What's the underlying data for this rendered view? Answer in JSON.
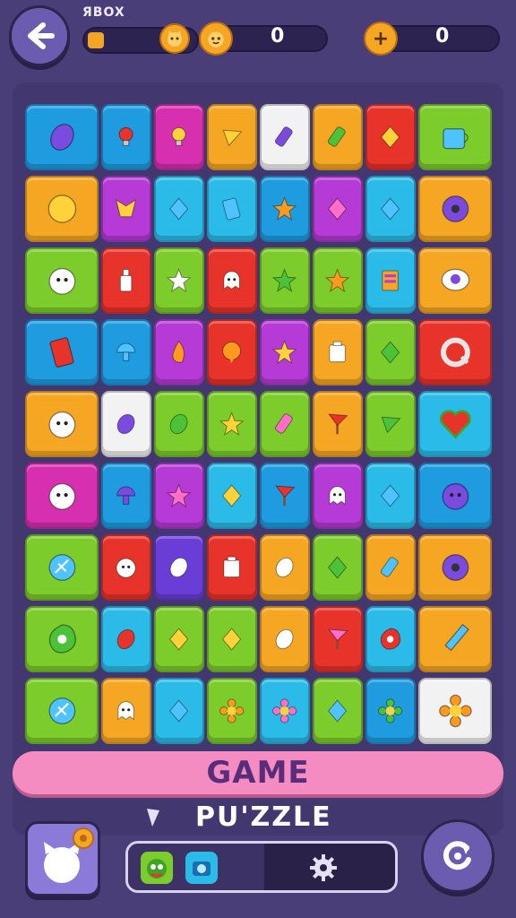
{
  "header": {
    "label": "ЯBOX",
    "progress_fraction": 0.12,
    "score": "0",
    "coins": "0",
    "back_icon": "arrow-left-icon",
    "score_icon": "cat-face-icon",
    "coins_icon": "plus-coin-icon"
  },
  "board": {
    "columns": 8,
    "tiles": [
      {
        "color": "#1f9be0",
        "icon": "purple-bean"
      },
      {
        "color": "#1f9be0",
        "icon": "red-bulb"
      },
      {
        "color": "#d62fb0",
        "icon": "yellow-bulb"
      },
      {
        "color": "#f5a623",
        "icon": "yellow-triangle"
      },
      {
        "color": "#f2f2f2",
        "icon": "purple-gem"
      },
      {
        "color": "#f5a623",
        "icon": "green-gem"
      },
      {
        "color": "#e8332b",
        "icon": "yellow-diamond"
      },
      {
        "color": "#7ccc2b",
        "icon": "blue-cup"
      },
      {
        "color": "#f5a623",
        "icon": "yellow-ball"
      },
      {
        "color": "#b53ad6",
        "icon": "yellow-cat"
      },
      {
        "color": "#2bbbe8",
        "icon": "blue-diamond"
      },
      {
        "color": "#2bbbe8",
        "icon": "blue-card"
      },
      {
        "color": "#1f9be0",
        "icon": "orange-star"
      },
      {
        "color": "#b53ad6",
        "icon": "pink-diamond"
      },
      {
        "color": "#2bbbe8",
        "icon": "blue-diamond"
      },
      {
        "color": "#f5a623",
        "icon": "purple-donut"
      },
      {
        "color": "#7ccc2b",
        "icon": "cat-face"
      },
      {
        "color": "#e8332b",
        "icon": "bottle"
      },
      {
        "color": "#7ccc2b",
        "icon": "white-star"
      },
      {
        "color": "#e8332b",
        "icon": "white-ghost"
      },
      {
        "color": "#7ccc2b",
        "icon": "green-star"
      },
      {
        "color": "#7ccc2b",
        "icon": "orange-star"
      },
      {
        "color": "#2bbbe8",
        "icon": "stripe-box"
      },
      {
        "color": "#f5a623",
        "icon": "eye"
      },
      {
        "color": "#1f9be0",
        "icon": "red-card"
      },
      {
        "color": "#1f9be0",
        "icon": "blue-mushroom"
      },
      {
        "color": "#b53ad6",
        "icon": "orange-flame"
      },
      {
        "color": "#e8332b",
        "icon": "orange-bubble"
      },
      {
        "color": "#b53ad6",
        "icon": "yellow-star"
      },
      {
        "color": "#f5a623",
        "icon": "white-jar"
      },
      {
        "color": "#7ccc2b",
        "icon": "green-diamond"
      },
      {
        "color": "#e8332b",
        "icon": "grey-ring"
      },
      {
        "color": "#f5a623",
        "icon": "cat-face"
      },
      {
        "color": "#f2f2f2",
        "icon": "purple-bean"
      },
      {
        "color": "#7ccc2b",
        "icon": "green-bean"
      },
      {
        "color": "#7ccc2b",
        "icon": "yellow-star"
      },
      {
        "color": "#7ccc2b",
        "icon": "pink-gem"
      },
      {
        "color": "#f5a623",
        "icon": "red-flag"
      },
      {
        "color": "#7ccc2b",
        "icon": "green-triangle"
      },
      {
        "color": "#2bbbe8",
        "icon": "red-heart"
      },
      {
        "color": "#d62fb0",
        "icon": "cat-face"
      },
      {
        "color": "#1f9be0",
        "icon": "purple-mushroom"
      },
      {
        "color": "#b53ad6",
        "icon": "pink-star"
      },
      {
        "color": "#2bbbe8",
        "icon": "yellow-diamond"
      },
      {
        "color": "#1f9be0",
        "icon": "red-flag"
      },
      {
        "color": "#b53ad6",
        "icon": "white-ghost"
      },
      {
        "color": "#2bbbe8",
        "icon": "blue-diamond"
      },
      {
        "color": "#1f9be0",
        "icon": "purple-face"
      },
      {
        "color": "#7ccc2b",
        "icon": "blue-shell"
      },
      {
        "color": "#e8332b",
        "icon": "cat-face"
      },
      {
        "color": "#6a3ed6",
        "icon": "white-bean"
      },
      {
        "color": "#e8332b",
        "icon": "white-jar"
      },
      {
        "color": "#f5a623",
        "icon": "white-bean"
      },
      {
        "color": "#7ccc2b",
        "icon": "green-diamond"
      },
      {
        "color": "#f5a623",
        "icon": "blue-gem"
      },
      {
        "color": "#f5a623",
        "icon": "purple-donut"
      },
      {
        "color": "#7ccc2b",
        "icon": "green-blob"
      },
      {
        "color": "#2bbbe8",
        "icon": "red-bean"
      },
      {
        "color": "#7ccc2b",
        "icon": "yellow-diamond"
      },
      {
        "color": "#7ccc2b",
        "icon": "yellow-diamond"
      },
      {
        "color": "#f5a623",
        "icon": "white-bean"
      },
      {
        "color": "#e8332b",
        "icon": "pink-flag"
      },
      {
        "color": "#2bbbe8",
        "icon": "red-blob"
      },
      {
        "color": "#f5a623",
        "icon": "blue-pencil"
      },
      {
        "color": "#7ccc2b",
        "icon": "blue-shell"
      },
      {
        "color": "#f5a623",
        "icon": "white-ghost"
      },
      {
        "color": "#2bbbe8",
        "icon": "blue-diamond"
      },
      {
        "color": "#7ccc2b",
        "icon": "orange-flower"
      },
      {
        "color": "#2bbbe8",
        "icon": "pink-flower"
      },
      {
        "color": "#7ccc2b",
        "icon": "blue-diamond"
      },
      {
        "color": "#1f9be0",
        "icon": "green-flower"
      },
      {
        "color": "#f2f2f2",
        "icon": "orange-flower"
      }
    ]
  },
  "banner": {
    "title": "GAME"
  },
  "subtitle": {
    "text": "PU'ZZLE"
  },
  "controls": {
    "profile_icon": "profile-badge-icon",
    "tray_items": [
      "green-creature-icon",
      "camera-icon"
    ],
    "settings_icon": "gear-icon",
    "restart_icon": "restart-icon"
  }
}
